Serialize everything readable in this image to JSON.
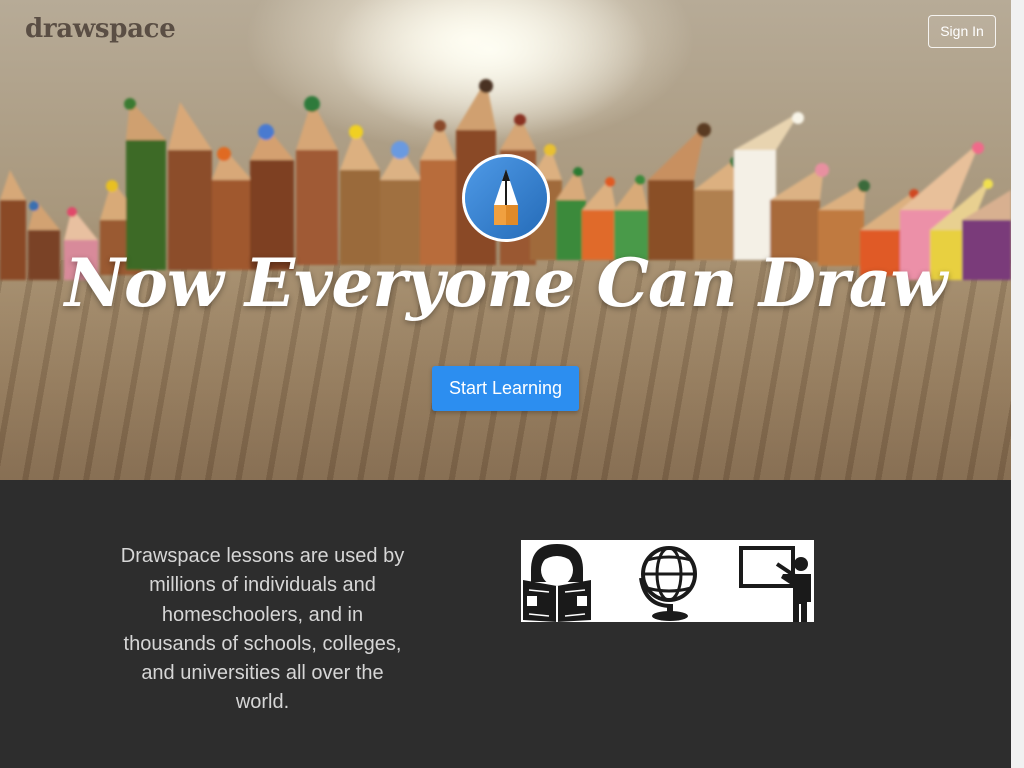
{
  "header": {
    "brand": "drawspace",
    "signin_label": "Sign In"
  },
  "hero": {
    "logo_icon": "pencil-circle-icon",
    "headline": "Now Everyone Can Draw",
    "cta_label": "Start Learning"
  },
  "info": {
    "text": "Drawspace lessons are used by millions of individuals and homeschoolers, and in thousands of schools, colleges, and universities all over the world.",
    "icons": [
      "reader-icon",
      "globe-icon",
      "teacher-icon"
    ]
  },
  "colors": {
    "cta": "#2c8ef0",
    "dark_band": "#2d2d2d",
    "brand": "#5a4e44"
  }
}
